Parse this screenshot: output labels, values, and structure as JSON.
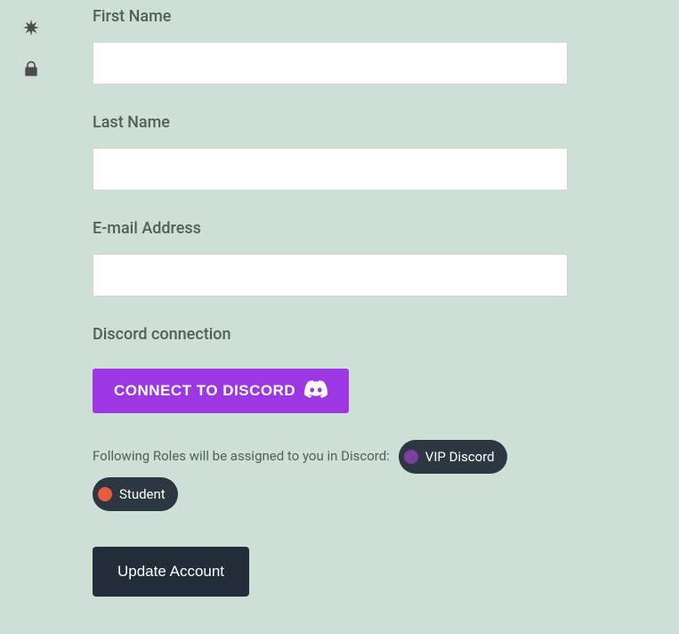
{
  "sidebar": {
    "items": [
      {
        "name": "settings-icon"
      },
      {
        "name": "security-icon"
      }
    ]
  },
  "form": {
    "first_name_label": "First Name",
    "first_name_value": "",
    "last_name_label": "Last Name",
    "last_name_value": "",
    "email_label": "E-mail Address",
    "email_value": ""
  },
  "discord": {
    "section_title": "Discord connection",
    "connect_label": "CONNECT TO DISCORD",
    "roles_text": "Following Roles will be assigned to you in Discord:",
    "roles": [
      {
        "label": "VIP Discord",
        "color": "#7b3fa0"
      },
      {
        "label": "Student",
        "color": "#e95c3a"
      }
    ]
  },
  "actions": {
    "update_label": "Update Account"
  }
}
